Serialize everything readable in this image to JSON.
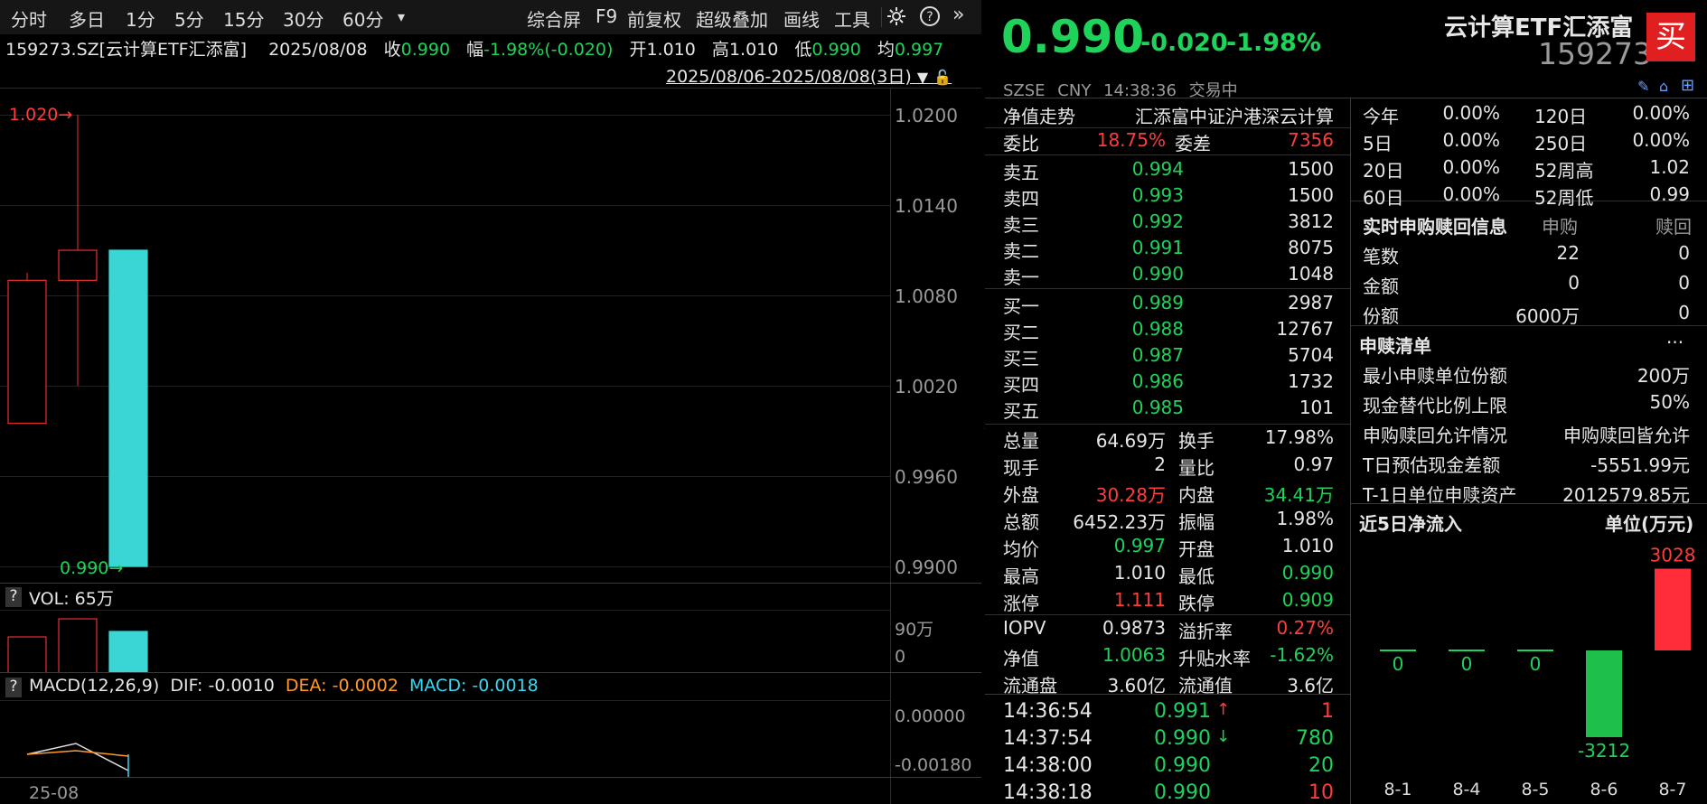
{
  "toolbar": {
    "tabs": [
      "分时",
      "多日",
      "1分",
      "5分",
      "15分",
      "30分",
      "60分"
    ],
    "more": "▾",
    "actions": [
      "综合屏",
      "F9",
      "前复权",
      "超级叠加",
      "画线",
      "工具"
    ],
    "icons": [
      "gear-icon",
      "help-icon",
      "expand-icon"
    ]
  },
  "infobar": {
    "code": "159273.SZ[云计算ETF汇添富]",
    "date": "2025/08/08",
    "close_label": "收",
    "close": "0.990",
    "change_label": "幅",
    "change": "-1.98%(-0.020)",
    "open_label": "开",
    "open": "1.010",
    "high_label": "高",
    "high": "1.010",
    "low_label": "低",
    "low": "0.990",
    "avg_label": "均",
    "avg": "0.997",
    "range": "2025/08/06-2025/08/08(3日)"
  },
  "price_axis": [
    "1.0200",
    "1.0140",
    "1.0080",
    "1.0020",
    "0.9960",
    "0.9900"
  ],
  "high_marker": "1.020",
  "low_marker": "0.990",
  "vol": {
    "help": "?",
    "label": "VOL: 65万",
    "axis_top": "90万",
    "axis_bottom": "0"
  },
  "macd": {
    "help": "?",
    "label": "MACD(12,26,9)",
    "dif": "DIF: -0.0010",
    "dea": "DEA: -0.0002",
    "macd": "MACD: -0.0018",
    "axis": [
      "0.00000",
      "-0.00180"
    ]
  },
  "date_axis": "25-08",
  "chart_data": {
    "type": "candlestick",
    "candles": [
      {
        "open": 0.9995,
        "close": 1.009,
        "high": 1.0095,
        "low": 0.9995,
        "color": "red"
      },
      {
        "open": 1.009,
        "close": 1.011,
        "high": 1.02,
        "low": 1.002,
        "color": "red"
      },
      {
        "open": 1.011,
        "close": 0.99,
        "high": 1.011,
        "low": 0.99,
        "color": "cyan"
      }
    ],
    "volume_max": "90万"
  },
  "quote": {
    "price": "0.990",
    "change": "-0.020",
    "pct": "-1.98%",
    "name": "云计算ETF汇添富",
    "code": "159273",
    "buy": "买",
    "exchange": "SZSE",
    "currency": "CNY",
    "time": "14:38:36",
    "status": "交易中"
  },
  "nav_row": {
    "label": "净值走势",
    "index": "汇添富中证沪港深云计算"
  },
  "bid_ratio": {
    "l1": "委比",
    "v1": "18.75%",
    "l2": "委差",
    "v2": "7356"
  },
  "asks": [
    {
      "label": "卖五",
      "price": "0.994",
      "vol": "1500"
    },
    {
      "label": "卖四",
      "price": "0.993",
      "vol": "1500"
    },
    {
      "label": "卖三",
      "price": "0.992",
      "vol": "3812"
    },
    {
      "label": "卖二",
      "price": "0.991",
      "vol": "8075"
    },
    {
      "label": "卖一",
      "price": "0.990",
      "vol": "1048"
    }
  ],
  "bids": [
    {
      "label": "买一",
      "price": "0.989",
      "vol": "2987"
    },
    {
      "label": "买二",
      "price": "0.988",
      "vol": "12767"
    },
    {
      "label": "买三",
      "price": "0.987",
      "vol": "5704"
    },
    {
      "label": "买四",
      "price": "0.986",
      "vol": "1732"
    },
    {
      "label": "买五",
      "price": "0.985",
      "vol": "101"
    }
  ],
  "stats": [
    {
      "l1": "总量",
      "v1": "64.69万",
      "c1": "w",
      "l2": "换手",
      "v2": "17.98%",
      "c2": "w"
    },
    {
      "l1": "现手",
      "v1": "2",
      "c1": "w",
      "l2": "量比",
      "v2": "0.97",
      "c2": "w"
    },
    {
      "l1": "外盘",
      "v1": "30.28万",
      "c1": "r",
      "l2": "内盘",
      "v2": "34.41万",
      "c2": "g"
    },
    {
      "l1": "总额",
      "v1": "6452.23万",
      "c1": "w",
      "l2": "振幅",
      "v2": "1.98%",
      "c2": "w"
    },
    {
      "l1": "均价",
      "v1": "0.997",
      "c1": "g",
      "l2": "开盘",
      "v2": "1.010",
      "c2": "w"
    },
    {
      "l1": "最高",
      "v1": "1.010",
      "c1": "w",
      "l2": "最低",
      "v2": "0.990",
      "c2": "g"
    },
    {
      "l1": "涨停",
      "v1": "1.111",
      "c1": "r",
      "l2": "跌停",
      "v2": "0.909",
      "c2": "g"
    }
  ],
  "etf": [
    {
      "l1": "IOPV",
      "v1": "0.9873",
      "c1": "w",
      "l2": "溢折率",
      "v2": "0.27%",
      "c2": "r"
    },
    {
      "l1": "净值",
      "v1": "1.0063",
      "c1": "g",
      "l2": "升贴水率",
      "v2": "-1.62%",
      "c2": "g"
    },
    {
      "l1": "流通盘",
      "v1": "3.60亿",
      "c1": "w",
      "l2": "流通值",
      "v2": "3.6亿",
      "c2": "w"
    }
  ],
  "ticks": [
    {
      "time": "14:36:54",
      "price": "0.991",
      "arrow": "↑",
      "vol": "1",
      "pc": "g",
      "vc": "r",
      "ac": "r"
    },
    {
      "time": "14:37:54",
      "price": "0.990",
      "arrow": "↓",
      "vol": "780",
      "pc": "g",
      "vc": "g",
      "ac": "g"
    },
    {
      "time": "14:38:00",
      "price": "0.990",
      "arrow": "",
      "vol": "20",
      "pc": "g",
      "vc": "g",
      "ac": "g"
    },
    {
      "time": "14:38:18",
      "price": "0.990",
      "arrow": "",
      "vol": "10",
      "pc": "g",
      "vc": "r",
      "ac": "g"
    }
  ],
  "perf": [
    {
      "l1": "今年",
      "v1": "0.00%",
      "l2": "120日",
      "v2": "0.00%"
    },
    {
      "l1": "5日",
      "v1": "0.00%",
      "l2": "250日",
      "v2": "0.00%"
    },
    {
      "l1": "20日",
      "v1": "0.00%",
      "l2": "52周高",
      "v2": "1.02"
    },
    {
      "l1": "60日",
      "v1": "0.00%",
      "l2": "52周低",
      "v2": "0.99"
    }
  ],
  "creation": {
    "title": "实时申购赎回信息",
    "col1": "申购",
    "col2": "赎回",
    "rows": [
      {
        "label": "笔数",
        "v1": "22",
        "v2": "0"
      },
      {
        "label": "金额",
        "v1": "0",
        "v2": "0"
      },
      {
        "label": "份额",
        "v1": "6000万",
        "v2": "0"
      }
    ]
  },
  "pcf": {
    "title": "申赎清单",
    "more": "···",
    "rows": [
      {
        "label": "最小申赎单位份额",
        "value": "200万"
      },
      {
        "label": "现金替代比例上限",
        "value": "50%"
      },
      {
        "label": "申购赎回允许情况",
        "value": "申购赎回皆允许"
      },
      {
        "label": "T日预估现金差额",
        "value": "-5551.99元"
      },
      {
        "label": "T-1日单位申赎资产",
        "value": "2012579.85元"
      }
    ]
  },
  "flow": {
    "title": "近5日净流入",
    "unit": "单位(万元)",
    "chart_data": {
      "type": "bar",
      "categories": [
        "8-1",
        "8-4",
        "8-5",
        "8-6",
        "8-7"
      ],
      "values": [
        0,
        0,
        0,
        -3212,
        3028
      ],
      "labels": [
        "0",
        "0",
        "0",
        "-3212",
        "3028"
      ]
    }
  },
  "collapse": "»"
}
